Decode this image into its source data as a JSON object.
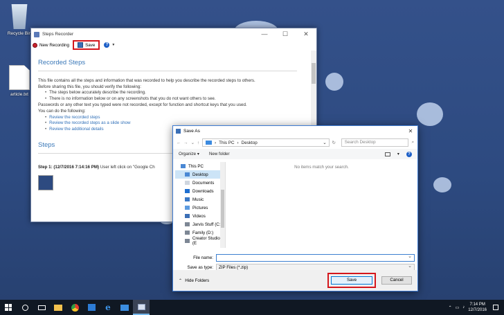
{
  "desktop": {
    "icons": [
      {
        "label": "Recycle Bin"
      },
      {
        "label": "article.txt"
      }
    ]
  },
  "steps_recorder": {
    "title": "Steps Recorder",
    "toolbar": {
      "new_recording": "New Recording",
      "save": "Save"
    },
    "heading": "Recorded Steps",
    "intro": "This file contains all the steps and information that was recorded to help you describe the recorded steps to others.",
    "verify": "Before sharing this file, you should verify the following:",
    "bullets": [
      "The steps below accurately describe the recording.",
      "There is no information below or on any screenshots that you do not want others to see."
    ],
    "note": "Passwords or any other text you typed were not recorded, except for function and shortcut keys that you used.",
    "can_do": "You can do the following:",
    "links": [
      "Review the recorded steps",
      "Review the recorded steps as a slide show",
      "Review the additional details"
    ],
    "steps_heading": "Steps",
    "step1_label": "Step 1: (12/7/2016 7:14:16 PM)",
    "step1_text": "User left click on \"Google Ch"
  },
  "save_dialog": {
    "title": "Save As",
    "path": [
      "This PC",
      "Desktop"
    ],
    "search_placeholder": "Search Desktop",
    "organize": "Organize ▾",
    "new_folder": "New folder",
    "nav_items": [
      "This PC",
      "Desktop",
      "Documents",
      "Downloads",
      "Music",
      "Pictures",
      "Videos",
      "Jarvis Stuff (C:)",
      "Family (D:)",
      "Creator Studio (E"
    ],
    "empty_message": "No items match your search.",
    "file_name_label": "File name:",
    "file_name_value": "",
    "save_as_type_label": "Save as type:",
    "save_as_type_value": "ZIP Files (*.zip)",
    "hide_folders": "Hide Folders",
    "save_button": "Save",
    "cancel_button": "Cancel"
  },
  "taskbar": {
    "time": "7:14 PM",
    "date": "12/7/2016"
  }
}
